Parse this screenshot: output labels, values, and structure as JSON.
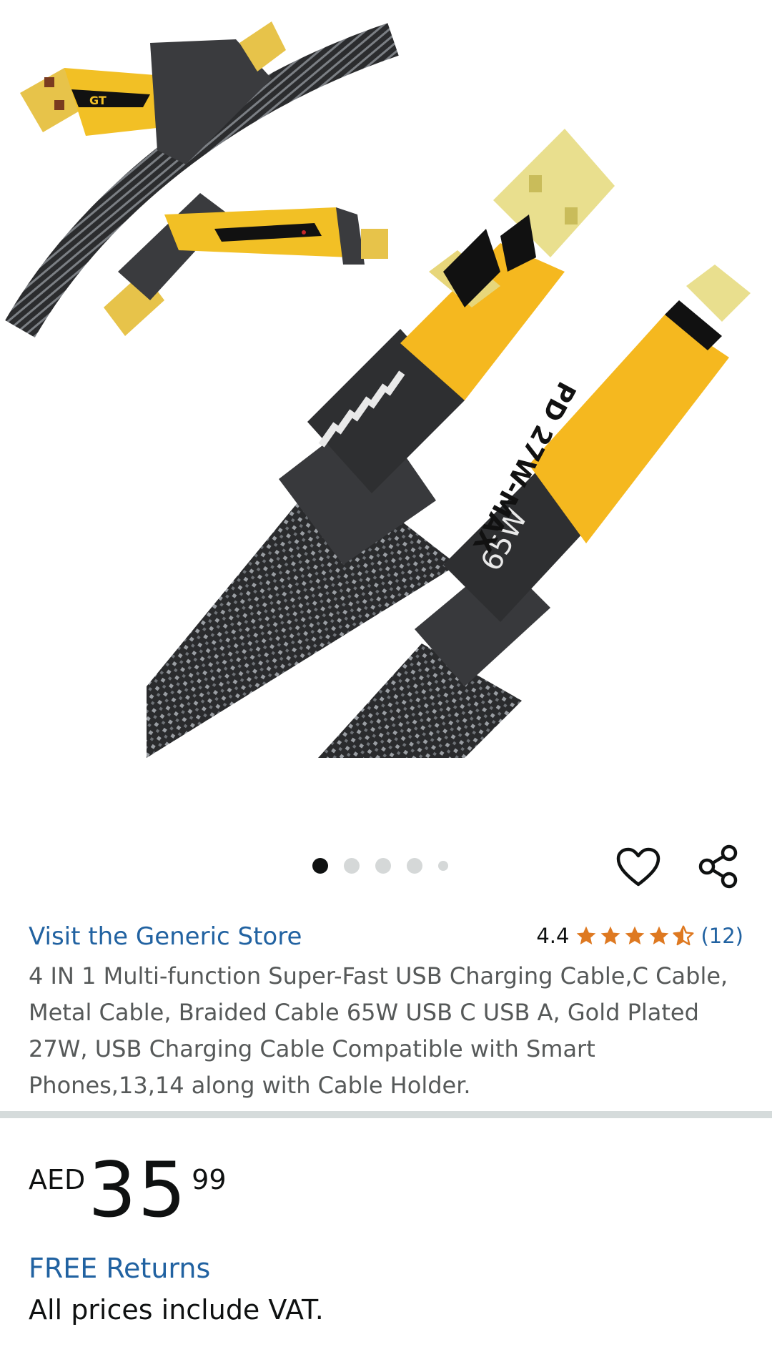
{
  "product": {
    "store_link": "Visit the Generic Store",
    "rating_value": "4.4",
    "rating_stars": 4.4,
    "review_count": "(12)",
    "title": "4 IN 1 Multi-function Super-Fast USB Charging Cable,C Cable, Metal Cable, Braided Cable 65W USB C USB A, Gold Plated 27W, USB Charging Cable Compatible with Smart Phones,13,14 along with Cable Holder."
  },
  "gallery": {
    "image_count": 5,
    "active_index": 0,
    "print_gt": "GT",
    "print_65w": "65W",
    "print_pd": "PD 27W-MAX"
  },
  "price": {
    "currency": "AED",
    "whole": "35",
    "fraction": "99"
  },
  "delivery": {
    "free_returns": "FREE Returns",
    "vat_note": "All prices include VAT."
  },
  "icons": {
    "wishlist": "heart-icon",
    "share": "share-icon"
  },
  "colors": {
    "link": "#2162a1",
    "star": "#de7921",
    "text": "#0f1111",
    "muted": "#565959",
    "cable_yellow": "#f5b81f"
  }
}
